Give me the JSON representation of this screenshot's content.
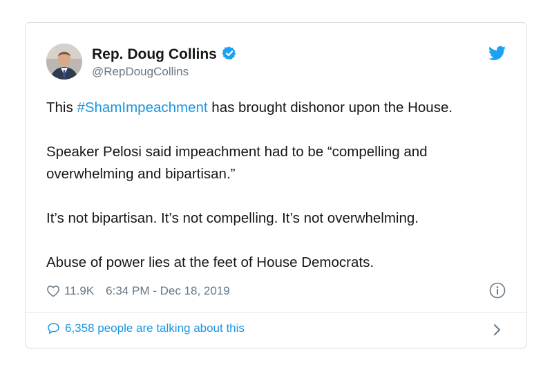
{
  "author": {
    "name": "Rep. Doug Collins",
    "handle": "@RepDougCollins"
  },
  "tweet": {
    "line1_before": "This ",
    "hashtag": "#ShamImpeachment",
    "line1_after": " has brought dishonor upon the House.",
    "para2_line1": "Speaker Pelosi said impeachment had to be “compelling and",
    "para2_line2": "overwhelming and bipartisan.”",
    "para3": "It’s not bipartisan. It’s not compelling. It’s not overwhelming.",
    "para4": "Abuse of power lies at the feet of House Democrats."
  },
  "meta": {
    "likes": "11.9K",
    "timestamp": "6:34 PM - Dec 18, 2019"
  },
  "footer": {
    "talking": "6,358 people are talking about this"
  },
  "icons": {
    "verified": "verified-badge-icon",
    "brand": "twitter-bird-icon",
    "like": "heart-icon",
    "info": "info-icon",
    "reply": "speech-bubble-icon",
    "more": "chevron-right-icon"
  },
  "colors": {
    "link": "#1b95e0",
    "secondary_text": "#657786",
    "primary_text": "#14171a",
    "border": "#d9dee2"
  }
}
